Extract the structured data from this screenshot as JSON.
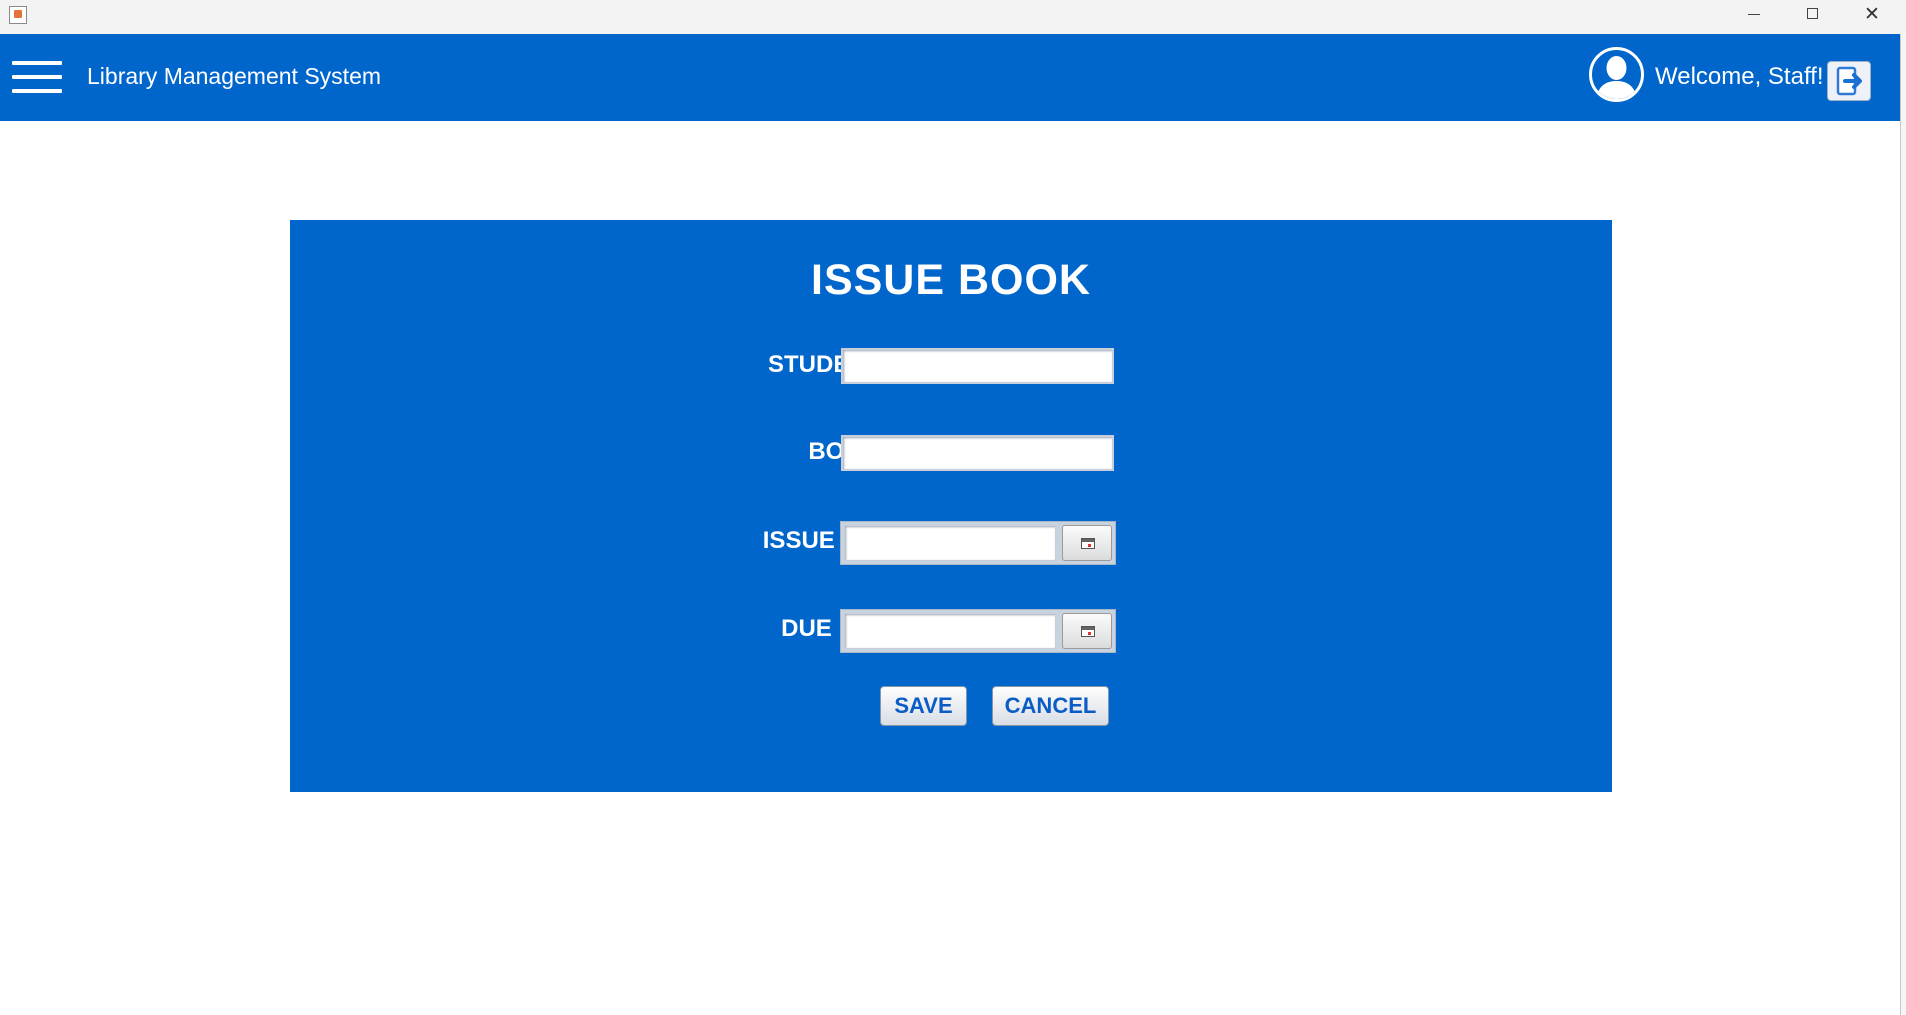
{
  "window": {
    "close_glyph": "✕",
    "colors": {
      "title_bar": "#f3f3f3"
    }
  },
  "header": {
    "menu_icon": "hamburger-icon",
    "title": "Library Management System",
    "welcome_text": "Welcome, Staff!",
    "avatar_icon": "user-silhouette-icon",
    "logout_icon": "logout-icon",
    "colors": {
      "background": "#0066cc",
      "text": "#ffffff"
    }
  },
  "form": {
    "title": "ISSUE BOOK",
    "student_id": {
      "label": "STUDENT ID:",
      "value": ""
    },
    "book_id": {
      "label": "BOOK ID:",
      "value": ""
    },
    "issue_date": {
      "label": "ISSUE DATE:",
      "value": "",
      "picker_icon": "calendar-icon"
    },
    "due_date": {
      "label": "DUE DATE:",
      "value": "",
      "picker_icon": "calendar-icon"
    },
    "save_label": "SAVE",
    "cancel_label": "CANCEL",
    "colors": {
      "panel": "#0066cc",
      "button_text": "#0b5cc4"
    }
  }
}
